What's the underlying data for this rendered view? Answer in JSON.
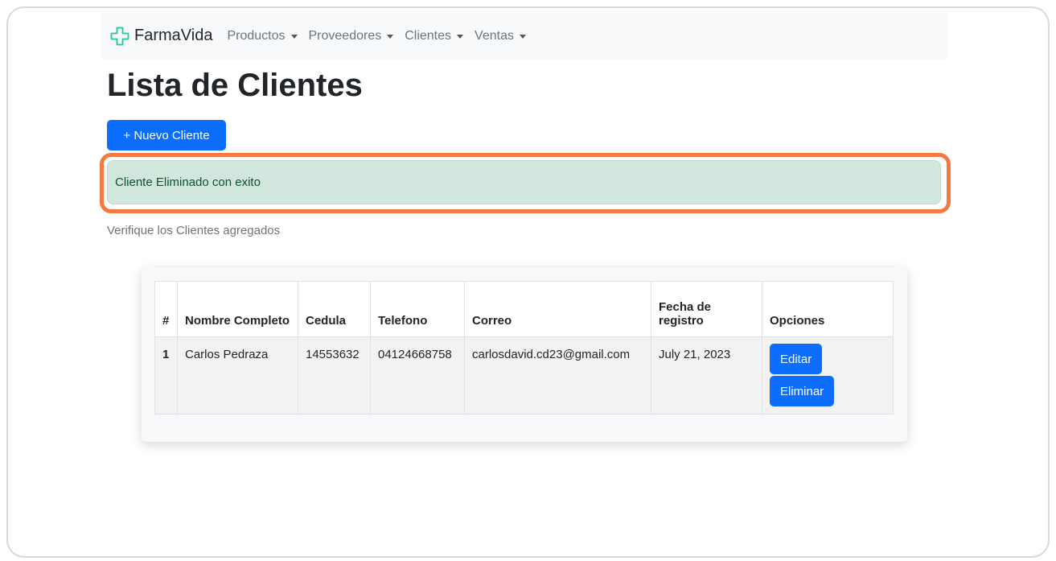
{
  "navbar": {
    "brand": "FarmaVida",
    "items": [
      {
        "label": "Productos"
      },
      {
        "label": "Proveedores"
      },
      {
        "label": "Clientes"
      },
      {
        "label": "Ventas"
      }
    ]
  },
  "page": {
    "title": "Lista de Clientes",
    "new_button": "+ Nuevo Cliente",
    "alert": "Cliente Eliminado con exito",
    "helper": "Verifique los Clientes agregados"
  },
  "table": {
    "headers": [
      "#",
      "Nombre Completo",
      "Cedula",
      "Telefono",
      "Correo",
      "Fecha de registro",
      "Opciones"
    ],
    "rows": [
      {
        "num": "1",
        "nombre": "Carlos Pedraza",
        "cedula": "14553632",
        "telefono": "04124668758",
        "correo": "carlosdavid.cd23@gmail.com",
        "fecha": "July 21, 2023",
        "edit_label": "Editar",
        "delete_label": "Eliminar"
      }
    ]
  },
  "colors": {
    "primary": "#0d6efd",
    "alert_bg": "#d1e7dd",
    "highlight": "#f47a42",
    "navbar_bg": "#f8f9fa"
  },
  "icons": {
    "brand": "medical-cross-icon",
    "dropdown": "caret-down-icon"
  }
}
